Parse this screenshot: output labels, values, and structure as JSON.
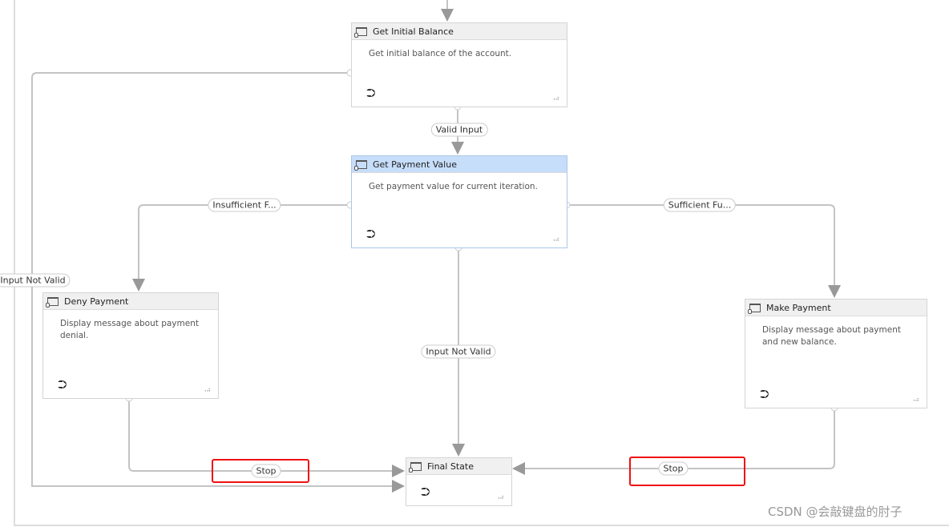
{
  "nodes": {
    "get_initial_balance": {
      "title": "Get Initial Balance",
      "description": "Get initial balance of the account."
    },
    "get_payment_value": {
      "title": "Get Payment Value",
      "description": "Get payment value for current iteration."
    },
    "deny_payment": {
      "title": "Deny Payment",
      "description": "Display message about payment denial."
    },
    "make_payment": {
      "title": "Make Payment",
      "description": "Display message about payment and new balance."
    },
    "final_state": {
      "title": "Final State"
    }
  },
  "transitions": {
    "valid_input": "Valid Input",
    "input_not_valid_left": "Input Not Valid",
    "insufficient": "Insufficient F...",
    "sufficient": "Sufficient Fu...",
    "input_not_valid_center": "Input Not Valid",
    "stop_left": "Stop",
    "stop_right": "Stop"
  },
  "highlight_color": "#f01010",
  "selected_header_color": "#c7defa",
  "watermark": "CSDN @会敲键盘的肘子"
}
